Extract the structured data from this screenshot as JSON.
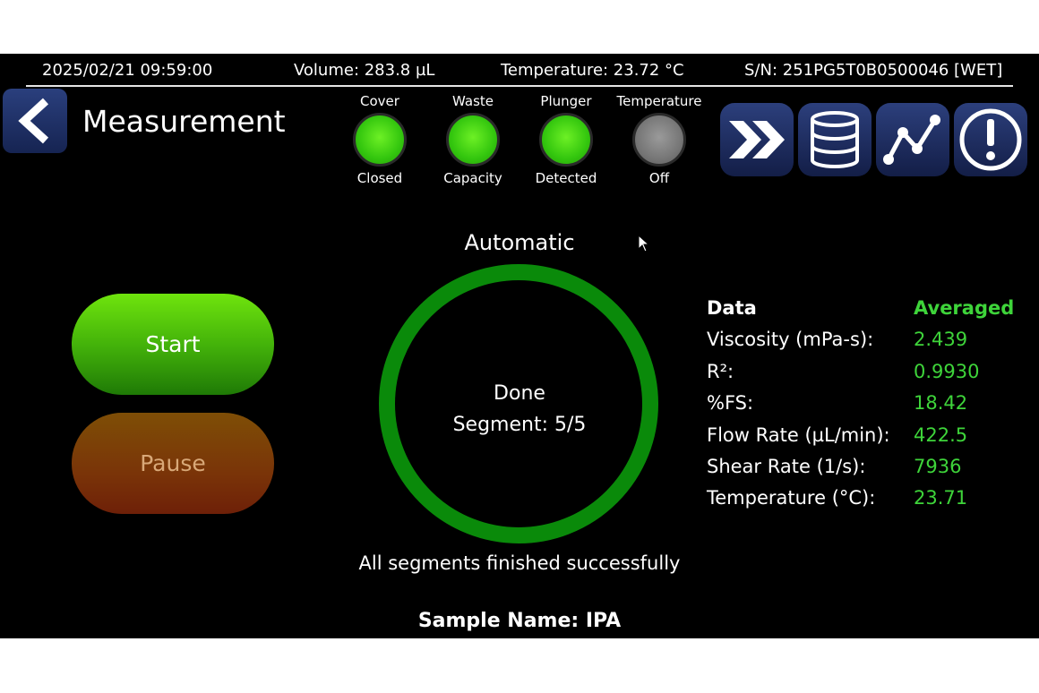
{
  "status_bar": {
    "datetime": "2025/02/21 09:59:00",
    "volume": "Volume: 283.8 µL",
    "temperature": "Temperature: 23.72 °C",
    "serial": "S/N: 251PG5T0B0500046 [WET]"
  },
  "header": {
    "title": "Measurement",
    "back_icon": "chevron-left-icon"
  },
  "indicators": [
    {
      "top": "Cover",
      "bottom": "Closed",
      "state": "green",
      "color": "#2ecc0a"
    },
    {
      "top": "Waste",
      "bottom": "Capacity",
      "state": "green",
      "color": "#2ecc0a"
    },
    {
      "top": "Plunger",
      "bottom": "Detected",
      "state": "green",
      "color": "#2ecc0a"
    },
    {
      "top": "Temperature",
      "bottom": "Off",
      "state": "gray",
      "color": "#7a7a7a"
    }
  ],
  "toolbar": [
    {
      "icon": "fast-forward-icon"
    },
    {
      "icon": "database-icon"
    },
    {
      "icon": "chart-line-icon"
    },
    {
      "icon": "alert-icon"
    }
  ],
  "mode": "Automatic",
  "progress": {
    "status": "Done",
    "segment": "Segment: 5/5",
    "fraction": 1.0,
    "message": "All segments finished successfully"
  },
  "buttons": {
    "start": "Start",
    "pause": "Pause"
  },
  "data_table": {
    "header_label": "Data",
    "header_value": "Averaged",
    "rows": [
      {
        "label": "Viscosity (mPa-s):",
        "value": "2.439"
      },
      {
        "label": "R²:",
        "value": "0.9930"
      },
      {
        "label": "%FS:",
        "value": "18.42"
      },
      {
        "label": "Flow Rate (µL/min):",
        "value": "422.5"
      },
      {
        "label": "Shear Rate (1/s):",
        "value": "7936"
      },
      {
        "label": "Temperature (°C):",
        "value": "23.71"
      }
    ],
    "value_color": "#3ed43a"
  },
  "sample_name": "Sample Name: IPA",
  "colors": {
    "accent_green": "#3ed43a",
    "ring_green": "#0a8a0a",
    "button_blue": "#1e2e66"
  }
}
